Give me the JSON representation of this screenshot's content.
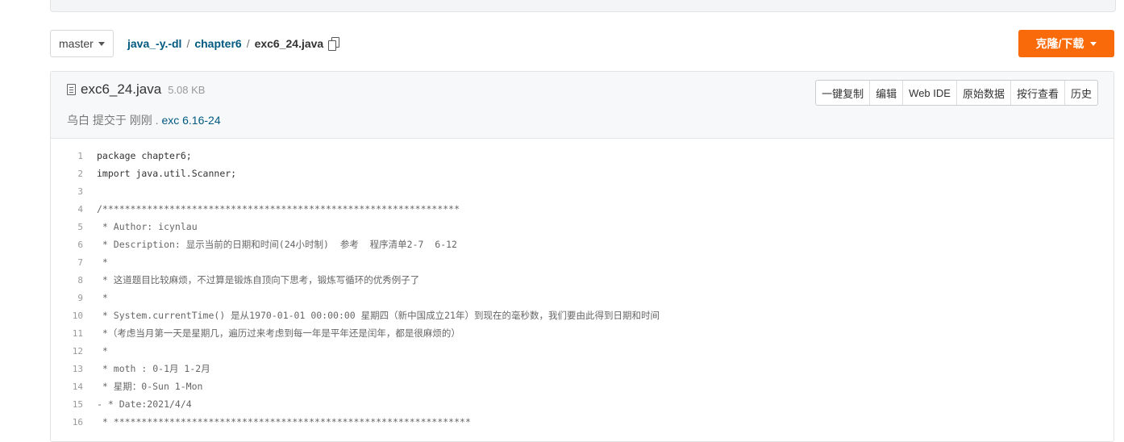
{
  "nav": {
    "branch": "master",
    "breadcrumb": {
      "repo": "java_-y.-dl",
      "sep1": "/",
      "folder": "chapter6",
      "sep2": "/",
      "file": "exc6_24.java"
    },
    "clone_label": "克隆/下载"
  },
  "file": {
    "name": "exc6_24.java",
    "size": "5.08 KB",
    "commit": {
      "prefix": "乌白 提交于 刚刚 .",
      "message": "exc 6.16-24"
    },
    "actions": [
      "一键复制",
      "编辑",
      "Web IDE",
      "原始数据",
      "按行查看",
      "历史"
    ]
  },
  "code_lines": [
    {
      "n": "1",
      "text": "package chapter6;",
      "type": "code"
    },
    {
      "n": "2",
      "text": "import java.util.Scanner;",
      "type": "code"
    },
    {
      "n": "3",
      "text": "",
      "type": "code"
    },
    {
      "n": "4",
      "text": "/****************************************************************",
      "type": "comment"
    },
    {
      "n": "5",
      "text": " * Author: icynlau",
      "type": "comment"
    },
    {
      "n": "6",
      "text": " * Description: 显示当前的日期和时间(24小时制)  参考  程序清单2-7  6-12",
      "type": "comment"
    },
    {
      "n": "7",
      "text": " *",
      "type": "comment"
    },
    {
      "n": "8",
      "text": " * 这道题目比较麻烦，不过算是锻炼自顶向下思考，锻炼写循环的优秀例子了",
      "type": "comment"
    },
    {
      "n": "9",
      "text": " *",
      "type": "comment"
    },
    {
      "n": "10",
      "text": " * System.currentTime() 是从1970-01-01 00:00:00 星期四（新中国成立21年）到现在的毫秒数，我们要由此得到日期和时间",
      "type": "comment"
    },
    {
      "n": "11",
      "text": " *（考虑当月第一天是星期几，遍历过来考虑到每一年是平年还是闰年，都是很麻烦的）",
      "type": "comment"
    },
    {
      "n": "12",
      "text": " *",
      "type": "comment"
    },
    {
      "n": "13",
      "text": " * moth : 0-1月 1-2月",
      "type": "comment"
    },
    {
      "n": "14",
      "text": " * 星期：0-Sun 1-Mon",
      "type": "comment"
    },
    {
      "n": "15",
      "text": "- * Date:2021/4/4",
      "type": "comment"
    },
    {
      "n": "16",
      "text": " * ****************************************************************",
      "type": "comment"
    }
  ]
}
